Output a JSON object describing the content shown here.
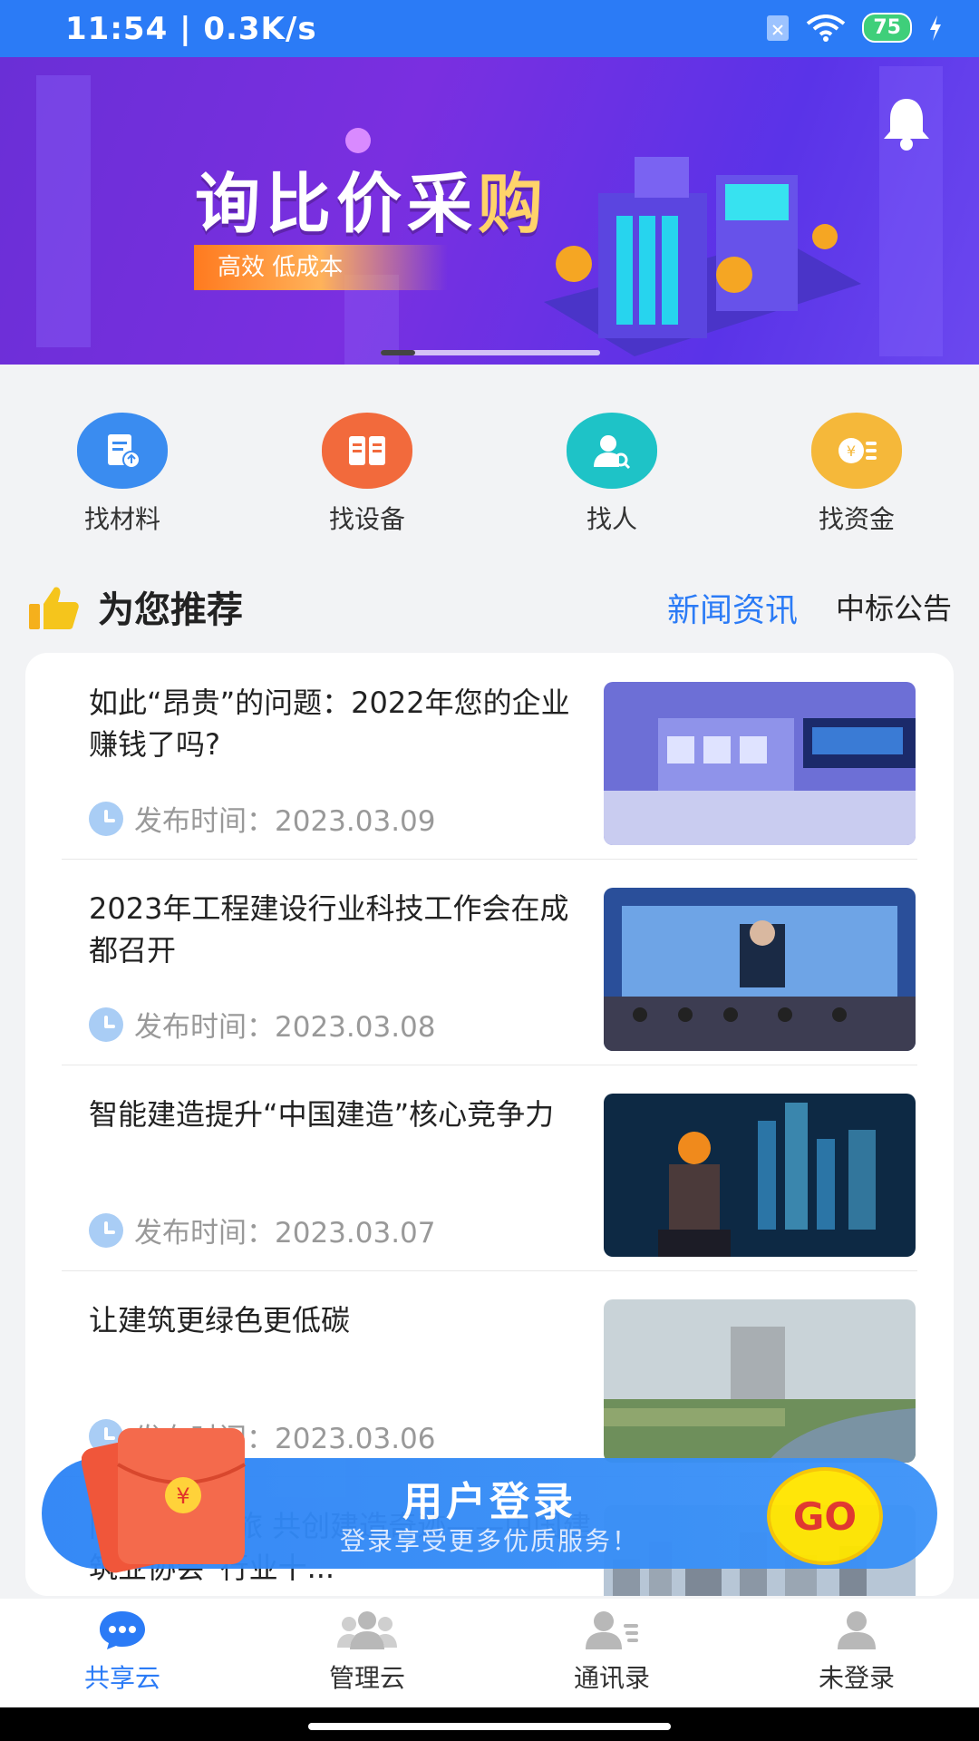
{
  "status_bar": {
    "time_speed": "11:54 | 0.3K/s",
    "battery": "75"
  },
  "banner": {
    "title_part1": "询比价采",
    "title_part2": "购",
    "subtitle": "高效  低成本"
  },
  "quick_links": [
    {
      "label": "找材料",
      "color": "#3a8cf0"
    },
    {
      "label": "找设备",
      "color": "#f26a3c"
    },
    {
      "label": "找人",
      "color": "#1ec3c7"
    },
    {
      "label": "找资金",
      "color": "#f5b83a"
    }
  ],
  "section": {
    "title": "为您推荐",
    "tab_news": "新闻资讯",
    "tab_notice": "中标公告"
  },
  "news": [
    {
      "title": "如此“昂贵”的问题：2022年您的企业赚钱了吗?",
      "meta": "发布时间：2023.03.09"
    },
    {
      "title": "2023年工程建设行业科技工作会在成都召开",
      "meta": "发布时间：2023.03.08"
    },
    {
      "title": "智能建造提升“中国建造”核心竞争力",
      "meta": "发布时间：2023.03.07"
    },
    {
      "title": "让建筑更绿色更低碳",
      "meta": "发布时间：2023.03.06"
    },
    {
      "title": "同赴创新之旅 共创建造奇迹——中国建筑业协会“行业十...",
      "meta": ""
    }
  ],
  "login_banner": {
    "title": "用户登录",
    "subtitle": "登录享受更多优质服务！",
    "go": "GO",
    "envelope_symbol": "¥"
  },
  "bottom_nav": [
    {
      "label": "共享云",
      "icon": "chat-bubble-icon",
      "active": true
    },
    {
      "label": "管理云",
      "icon": "group-icon",
      "active": false
    },
    {
      "label": "通讯录",
      "icon": "contacts-icon",
      "active": false
    },
    {
      "label": "未登录",
      "icon": "person-icon",
      "active": false
    }
  ]
}
